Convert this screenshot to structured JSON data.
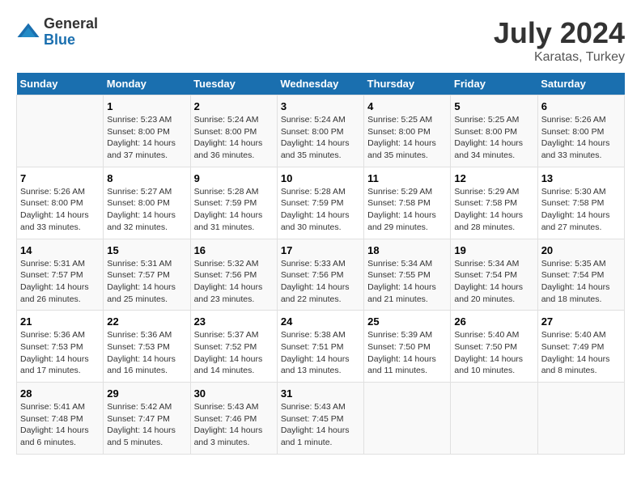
{
  "logo": {
    "general": "General",
    "blue": "Blue"
  },
  "title": "July 2024",
  "subtitle": "Karatas, Turkey",
  "days_of_week": [
    "Sunday",
    "Monday",
    "Tuesday",
    "Wednesday",
    "Thursday",
    "Friday",
    "Saturday"
  ],
  "weeks": [
    [
      {
        "day": "",
        "info": ""
      },
      {
        "day": "1",
        "info": "Sunrise: 5:23 AM\nSunset: 8:00 PM\nDaylight: 14 hours\nand 37 minutes."
      },
      {
        "day": "2",
        "info": "Sunrise: 5:24 AM\nSunset: 8:00 PM\nDaylight: 14 hours\nand 36 minutes."
      },
      {
        "day": "3",
        "info": "Sunrise: 5:24 AM\nSunset: 8:00 PM\nDaylight: 14 hours\nand 35 minutes."
      },
      {
        "day": "4",
        "info": "Sunrise: 5:25 AM\nSunset: 8:00 PM\nDaylight: 14 hours\nand 35 minutes."
      },
      {
        "day": "5",
        "info": "Sunrise: 5:25 AM\nSunset: 8:00 PM\nDaylight: 14 hours\nand 34 minutes."
      },
      {
        "day": "6",
        "info": "Sunrise: 5:26 AM\nSunset: 8:00 PM\nDaylight: 14 hours\nand 33 minutes."
      }
    ],
    [
      {
        "day": "7",
        "info": "Sunrise: 5:26 AM\nSunset: 8:00 PM\nDaylight: 14 hours\nand 33 minutes."
      },
      {
        "day": "8",
        "info": "Sunrise: 5:27 AM\nSunset: 8:00 PM\nDaylight: 14 hours\nand 32 minutes."
      },
      {
        "day": "9",
        "info": "Sunrise: 5:28 AM\nSunset: 7:59 PM\nDaylight: 14 hours\nand 31 minutes."
      },
      {
        "day": "10",
        "info": "Sunrise: 5:28 AM\nSunset: 7:59 PM\nDaylight: 14 hours\nand 30 minutes."
      },
      {
        "day": "11",
        "info": "Sunrise: 5:29 AM\nSunset: 7:58 PM\nDaylight: 14 hours\nand 29 minutes."
      },
      {
        "day": "12",
        "info": "Sunrise: 5:29 AM\nSunset: 7:58 PM\nDaylight: 14 hours\nand 28 minutes."
      },
      {
        "day": "13",
        "info": "Sunrise: 5:30 AM\nSunset: 7:58 PM\nDaylight: 14 hours\nand 27 minutes."
      }
    ],
    [
      {
        "day": "14",
        "info": "Sunrise: 5:31 AM\nSunset: 7:57 PM\nDaylight: 14 hours\nand 26 minutes."
      },
      {
        "day": "15",
        "info": "Sunrise: 5:31 AM\nSunset: 7:57 PM\nDaylight: 14 hours\nand 25 minutes."
      },
      {
        "day": "16",
        "info": "Sunrise: 5:32 AM\nSunset: 7:56 PM\nDaylight: 14 hours\nand 23 minutes."
      },
      {
        "day": "17",
        "info": "Sunrise: 5:33 AM\nSunset: 7:56 PM\nDaylight: 14 hours\nand 22 minutes."
      },
      {
        "day": "18",
        "info": "Sunrise: 5:34 AM\nSunset: 7:55 PM\nDaylight: 14 hours\nand 21 minutes."
      },
      {
        "day": "19",
        "info": "Sunrise: 5:34 AM\nSunset: 7:54 PM\nDaylight: 14 hours\nand 20 minutes."
      },
      {
        "day": "20",
        "info": "Sunrise: 5:35 AM\nSunset: 7:54 PM\nDaylight: 14 hours\nand 18 minutes."
      }
    ],
    [
      {
        "day": "21",
        "info": "Sunrise: 5:36 AM\nSunset: 7:53 PM\nDaylight: 14 hours\nand 17 minutes."
      },
      {
        "day": "22",
        "info": "Sunrise: 5:36 AM\nSunset: 7:53 PM\nDaylight: 14 hours\nand 16 minutes."
      },
      {
        "day": "23",
        "info": "Sunrise: 5:37 AM\nSunset: 7:52 PM\nDaylight: 14 hours\nand 14 minutes."
      },
      {
        "day": "24",
        "info": "Sunrise: 5:38 AM\nSunset: 7:51 PM\nDaylight: 14 hours\nand 13 minutes."
      },
      {
        "day": "25",
        "info": "Sunrise: 5:39 AM\nSunset: 7:50 PM\nDaylight: 14 hours\nand 11 minutes."
      },
      {
        "day": "26",
        "info": "Sunrise: 5:40 AM\nSunset: 7:50 PM\nDaylight: 14 hours\nand 10 minutes."
      },
      {
        "day": "27",
        "info": "Sunrise: 5:40 AM\nSunset: 7:49 PM\nDaylight: 14 hours\nand 8 minutes."
      }
    ],
    [
      {
        "day": "28",
        "info": "Sunrise: 5:41 AM\nSunset: 7:48 PM\nDaylight: 14 hours\nand 6 minutes."
      },
      {
        "day": "29",
        "info": "Sunrise: 5:42 AM\nSunset: 7:47 PM\nDaylight: 14 hours\nand 5 minutes."
      },
      {
        "day": "30",
        "info": "Sunrise: 5:43 AM\nSunset: 7:46 PM\nDaylight: 14 hours\nand 3 minutes."
      },
      {
        "day": "31",
        "info": "Sunrise: 5:43 AM\nSunset: 7:45 PM\nDaylight: 14 hours\nand 1 minute."
      },
      {
        "day": "",
        "info": ""
      },
      {
        "day": "",
        "info": ""
      },
      {
        "day": "",
        "info": ""
      }
    ]
  ]
}
